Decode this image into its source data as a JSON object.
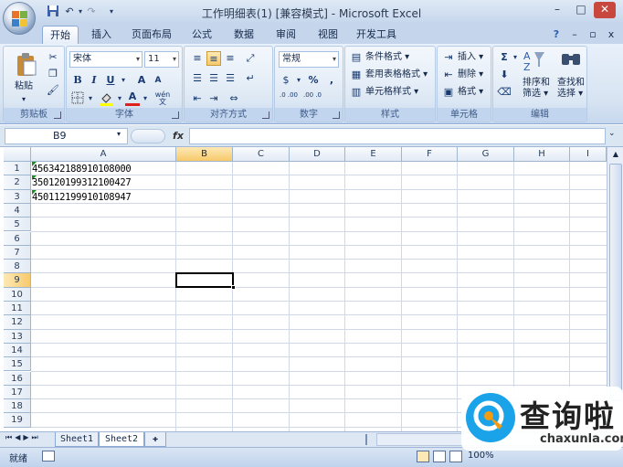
{
  "window": {
    "title": "工作明细表(1) [兼容模式] - Microsoft Excel",
    "minimize": "–",
    "restore": "□",
    "close": "✕"
  },
  "tabs": [
    "开始",
    "插入",
    "页面布局",
    "公式",
    "数据",
    "审阅",
    "视图",
    "开发工具"
  ],
  "ribbon": {
    "clipboard": {
      "label": "剪贴板",
      "paste": "粘贴"
    },
    "font": {
      "label": "字体",
      "name": "宋体",
      "size": "11",
      "bold": "B",
      "italic": "I",
      "underline": "U",
      "grow": "A",
      "shrink": "A",
      "wen": "wén",
      "fontcolor": "A"
    },
    "alignment": {
      "label": "对齐方式"
    },
    "number": {
      "label": "数字",
      "format": "常规",
      "percent": "%",
      "comma": ",",
      "inc": ".0 .00",
      "dec": ".00 .0"
    },
    "styles": {
      "label": "样式",
      "cond": "条件格式",
      "table": "套用表格格式",
      "cell": "单元格样式"
    },
    "cells": {
      "label": "单元格",
      "insert": "插入",
      "delete": "删除",
      "format": "格式"
    },
    "editing": {
      "label": "编辑",
      "sort": "排序和",
      "sort2": "筛选",
      "find": "查找和",
      "find2": "选择",
      "sigma": "Σ"
    }
  },
  "formula_bar": {
    "name_box": "B9",
    "fx": "fx",
    "value": ""
  },
  "columns": [
    "A",
    "B",
    "C",
    "D",
    "E",
    "F",
    "G",
    "H",
    "I"
  ],
  "rows": [
    "1",
    "2",
    "3",
    "4",
    "5",
    "6",
    "7",
    "8",
    "9",
    "10",
    "11",
    "12",
    "13",
    "14",
    "15",
    "16",
    "17",
    "18",
    "19"
  ],
  "cells": {
    "A1": "456342188910108000",
    "A2": "350120199312100427",
    "A3": "450112199910108947"
  },
  "sheets": [
    "Sheet1",
    "Sheet2"
  ],
  "status": {
    "ready": "就绪",
    "zoom": "100%",
    "zoom_minus": "–",
    "zoom_plus": "+"
  },
  "watermark": {
    "brand": "查询啦",
    "url": "chaxunla.com"
  }
}
